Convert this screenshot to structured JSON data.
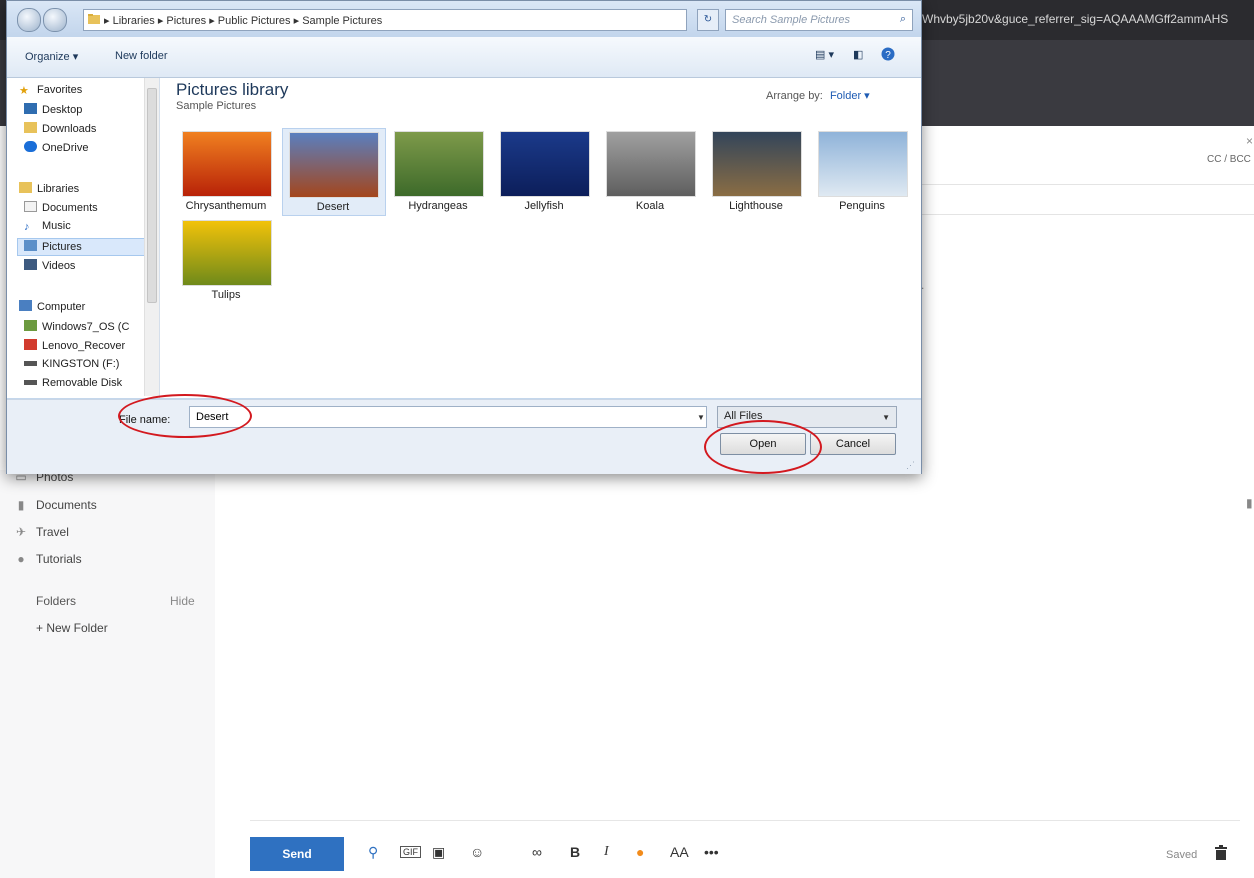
{
  "browser": {
    "url_fragment": "Whvby5jb20v&guce_referrer_sig=AQAAAMGff2ammAHS"
  },
  "compose": {
    "cc_bcc": "CC / BCC"
  },
  "mail_sidebar": {
    "items": [
      {
        "label": "Photos",
        "icon": "photos-icon"
      },
      {
        "label": "Documents",
        "icon": "document-icon"
      },
      {
        "label": "Travel",
        "icon": "airplane-icon"
      },
      {
        "label": "Tutorials",
        "icon": "help-icon"
      }
    ],
    "folders_label": "Folders",
    "hide_label": "Hide",
    "new_folder_label": "+ New Folder"
  },
  "bottom_toolbar": {
    "send_label": "Send",
    "gif_label": "GIF",
    "bold_label": "B",
    "italic_label": "I",
    "font_size_label": "AA",
    "more_label": "•••",
    "saved_label": "Saved"
  },
  "dialog": {
    "breadcrumb": [
      "Libraries",
      "Pictures",
      "Public Pictures",
      "Sample Pictures"
    ],
    "search_placeholder": "Search Sample Pictures",
    "toolbar": {
      "organize": "Organize ▾",
      "new_folder": "New folder"
    },
    "nav": {
      "favorites_header": "Favorites",
      "favorites": [
        "Desktop",
        "Downloads",
        "OneDrive"
      ],
      "libraries_header": "Libraries",
      "libraries": [
        "Documents",
        "Music",
        "Pictures",
        "Videos"
      ],
      "computer_header": "Computer",
      "drives": [
        "Windows7_OS (C",
        "Lenovo_Recover",
        "KINGSTON (F:)",
        "Removable Disk"
      ]
    },
    "library": {
      "title": "Pictures library",
      "subtitle": "Sample Pictures",
      "arrange_label": "Arrange by:",
      "arrange_value": "Folder ▾"
    },
    "pictures": [
      {
        "name": "Chrysanthemum",
        "colors": [
          "#f08020",
          "#b82208"
        ]
      },
      {
        "name": "Desert",
        "colors": [
          "#5a7fbf",
          "#a4461c"
        ]
      },
      {
        "name": "Hydrangeas",
        "colors": [
          "#7e9a4a",
          "#3d6a2a"
        ]
      },
      {
        "name": "Jellyfish",
        "colors": [
          "#1b3a8a",
          "#0c1e5a"
        ]
      },
      {
        "name": "Koala",
        "colors": [
          "#a0a0a0",
          "#5e5e5e"
        ]
      },
      {
        "name": "Lighthouse",
        "colors": [
          "#33455a",
          "#8a6d44"
        ]
      },
      {
        "name": "Penguins",
        "colors": [
          "#8fb3d9",
          "#dfe9f2"
        ]
      },
      {
        "name": "Tulips",
        "colors": [
          "#f2c20a",
          "#6f8a1a"
        ]
      }
    ],
    "selected_picture": "Desert",
    "file_name_label": "File name:",
    "file_name_value": "Desert",
    "file_type": "All Files",
    "open_label": "Open",
    "cancel_label": "Cancel"
  },
  "colors": {
    "accent": "#2f71c1",
    "annotation": "#d3191f"
  }
}
